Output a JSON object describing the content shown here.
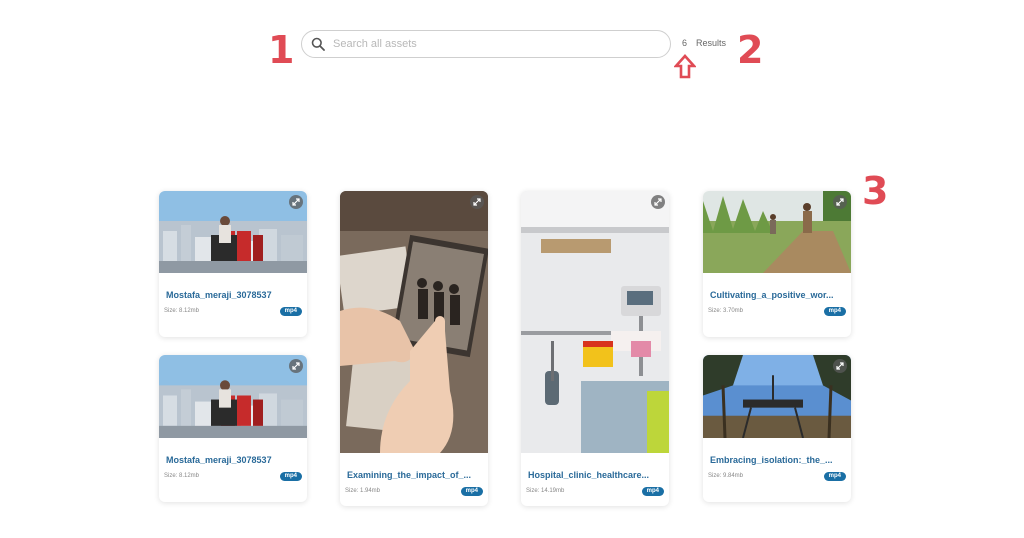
{
  "annotations": [
    "1",
    "2",
    "3"
  ],
  "search": {
    "placeholder": "Search all assets",
    "value": ""
  },
  "results": {
    "count": "6",
    "label": "Results"
  },
  "cards": [
    {
      "title": "Mostafa_meraji_3078537",
      "size": "Size: 8.12mb",
      "format": "mp4",
      "thumbnail": "rooftop-city"
    },
    {
      "title": "Mostafa_meraji_3078537",
      "size": "Size: 8.12mb",
      "format": "mp4",
      "thumbnail": "rooftop-city"
    },
    {
      "title": "Examining_the_impact_of_...",
      "size": "Size: 1.94mb",
      "format": "mp4",
      "thumbnail": "old-photograph"
    },
    {
      "title": "Hospital_clinic_healthcare...",
      "size": "Size: 14.19mb",
      "format": "mp4",
      "thumbnail": "hospital-room"
    },
    {
      "title": "Cultivating_a_positive_wor...",
      "size": "Size: 3.70mb",
      "format": "mp4",
      "thumbnail": "farm-field"
    },
    {
      "title": "Embracing_isolation:_the_...",
      "size": "Size: 9.84mb",
      "format": "mp4",
      "thumbnail": "forest-platform"
    }
  ],
  "colors": {
    "annotation": "#e04b55",
    "title": "#2a6a99",
    "badge": "#1a6fa5"
  }
}
